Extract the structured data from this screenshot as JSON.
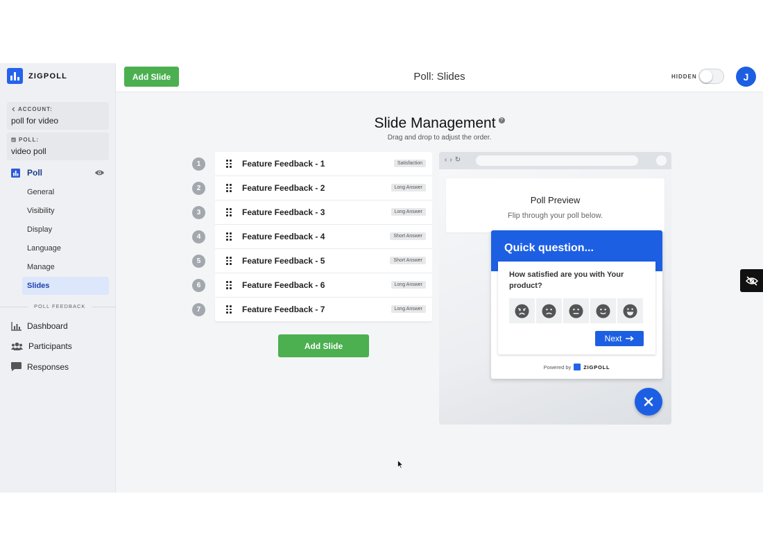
{
  "brand": {
    "name": "ZIGPOLL"
  },
  "sidebar": {
    "account_label": "ACCOUNT:",
    "account_value": "poll for video",
    "poll_label": "POLL:",
    "poll_value": "video poll",
    "poll_nav": "Poll",
    "sub_items": [
      "General",
      "Visibility",
      "Display",
      "Language",
      "Manage",
      "Slides"
    ],
    "section_title": "POLL FEEDBACK",
    "nav_items": [
      {
        "label": "Dashboard",
        "icon": "bar-chart-icon"
      },
      {
        "label": "Participants",
        "icon": "users-icon"
      },
      {
        "label": "Responses",
        "icon": "chat-bubble-icon"
      }
    ]
  },
  "topbar": {
    "add_slide_label": "Add Slide",
    "title": "Poll: Slides",
    "hidden_label": "HIDDEN",
    "avatar_initial": "J",
    "toggle_on": false
  },
  "main": {
    "title": "Slide Management",
    "subtitle": "Drag and drop to adjust the order.",
    "add_slide_label": "Add Slide",
    "slides": [
      {
        "number": "1",
        "name": "Feature Feedback - 1",
        "type": "Satisfaction"
      },
      {
        "number": "2",
        "name": "Feature Feedback - 2",
        "type": "Long Answer"
      },
      {
        "number": "3",
        "name": "Feature Feedback - 3",
        "type": "Long Answer"
      },
      {
        "number": "4",
        "name": "Feature Feedback - 4",
        "type": "Short Answer"
      },
      {
        "number": "5",
        "name": "Feature Feedback - 5",
        "type": "Short Answer"
      },
      {
        "number": "6",
        "name": "Feature Feedback - 6",
        "type": "Long Answer"
      },
      {
        "number": "7",
        "name": "Feature Feedback - 7",
        "type": "Long Answer"
      }
    ]
  },
  "preview": {
    "title": "Poll Preview",
    "subtitle": "Flip through your poll below.",
    "widget": {
      "heading": "Quick question...",
      "question": "How satisfied are you with Your product?",
      "faces": [
        "angry-face-icon",
        "frowning-face-icon",
        "neutral-face-icon",
        "smiling-face-icon",
        "grinning-face-icon"
      ],
      "next_label": "Next",
      "powered_by": "Powered by",
      "powered_brand": "ZIGPOLL"
    }
  },
  "colors": {
    "accent_blue": "#1d5fe3",
    "green": "#4caf50",
    "sidebar_bg": "#eef0f3"
  }
}
